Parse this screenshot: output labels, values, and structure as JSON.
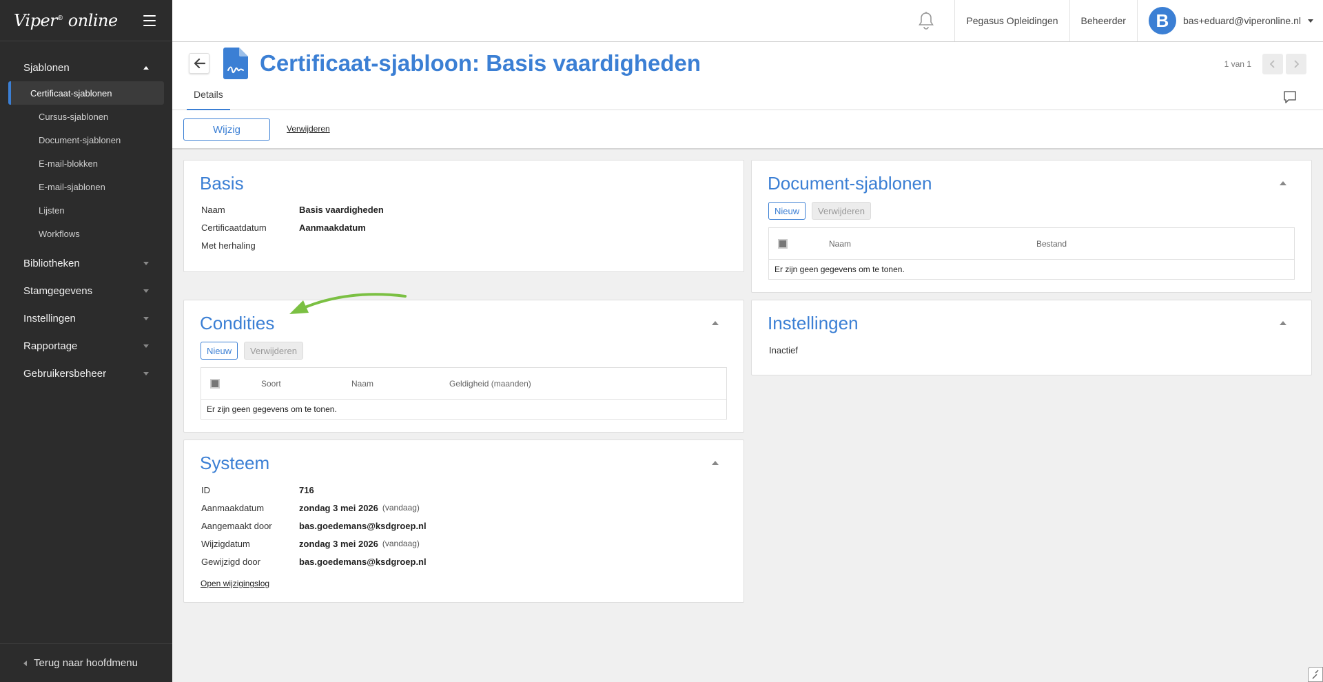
{
  "app": {
    "logo": "Viper",
    "logo_sup": "®",
    "logo_suffix": "online"
  },
  "sidebar": {
    "group_open": "Sjablonen",
    "items": [
      {
        "label": "Certificaat-sjablonen",
        "active": true
      },
      {
        "label": "Cursus-sjablonen"
      },
      {
        "label": "Document-sjablonen"
      },
      {
        "label": "E-mail-blokken"
      },
      {
        "label": "E-mail-sjablonen"
      },
      {
        "label": "Lijsten"
      },
      {
        "label": "Workflows"
      }
    ],
    "groups": [
      "Bibliotheken",
      "Stamgegevens",
      "Instellingen",
      "Rapportage",
      "Gebruikersbeheer"
    ],
    "footer": "Terug naar hoofdmenu"
  },
  "topbar": {
    "org": "Pegasus Opleidingen",
    "role": "Beheerder",
    "avatar_letter": "B",
    "user": "bas+eduard@viperonline.nl"
  },
  "page": {
    "title": "Certificaat-sjabloon: Basis vaardigheden",
    "pager": "1 van 1",
    "tab": "Details",
    "edit": "Wijzig",
    "delete": "Verwijderen"
  },
  "basis": {
    "title": "Basis",
    "rows": [
      {
        "k": "Naam",
        "v": "Basis vaardigheden"
      },
      {
        "k": "Certificaatdatum",
        "v": "Aanmaakdatum"
      },
      {
        "k": "Met herhaling",
        "v": ""
      }
    ]
  },
  "condities": {
    "title": "Condities",
    "new": "Nieuw",
    "delete": "Verwijderen",
    "columns": [
      "Soort",
      "Naam",
      "Geldigheid (maanden)"
    ],
    "empty": "Er zijn geen gegevens om te tonen."
  },
  "systeem": {
    "title": "Systeem",
    "rows": [
      {
        "k": "ID",
        "v": "716",
        "note": ""
      },
      {
        "k": "Aanmaakdatum",
        "v": "zondag 3 mei 2026",
        "note": "(vandaag)"
      },
      {
        "k": "Aangemaakt door",
        "v": "bas.goedemans@ksdgroep.nl",
        "note": ""
      },
      {
        "k": "Wijzigdatum",
        "v": "zondag 3 mei 2026",
        "note": "(vandaag)"
      },
      {
        "k": "Gewijzigd door",
        "v": "bas.goedemans@ksdgroep.nl",
        "note": ""
      }
    ],
    "log_link": "Open wijzigingslog"
  },
  "documenten": {
    "title": "Document-sjablonen",
    "new": "Nieuw",
    "delete": "Verwijderen",
    "columns": [
      "Naam",
      "Bestand"
    ],
    "empty": "Er zijn geen gegevens om te tonen."
  },
  "instellingen": {
    "title": "Instellingen",
    "status": "Inactief"
  },
  "colors": {
    "accent": "#3b7fd4",
    "sidebar": "#2c2c2c",
    "annotation_arrow": "#7bc043"
  }
}
